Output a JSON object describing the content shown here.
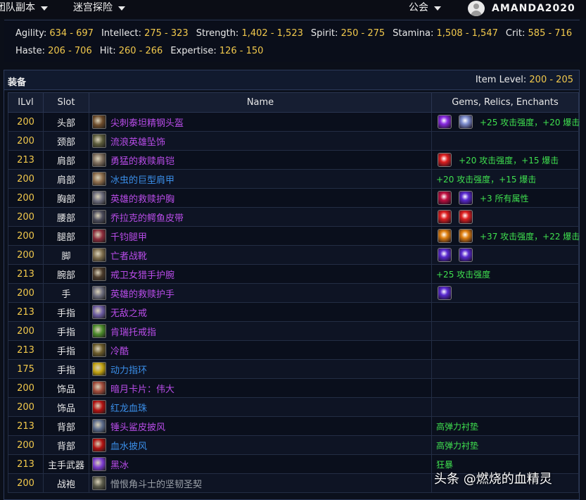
{
  "nav": {
    "item1": "团队副本",
    "item2": "迷宫探险",
    "guild": "公会",
    "username": "AMANDA2020"
  },
  "stats": {
    "row1": [
      {
        "label": "Agility:",
        "value": "634 - 697"
      },
      {
        "label": "Intellect:",
        "value": "275 - 323"
      },
      {
        "label": "Strength:",
        "value": "1,402 - 1,523"
      },
      {
        "label": "Spirit:",
        "value": "250 - 275"
      },
      {
        "label": "Stamina:",
        "value": "1,508 - 1,547"
      },
      {
        "label": "Crit:",
        "value": "585 - 716"
      }
    ],
    "row2": [
      {
        "label": "Haste:",
        "value": "206 - 706"
      },
      {
        "label": "Hit:",
        "value": "260 - 266"
      },
      {
        "label": "Expertise:",
        "value": "126 - 150"
      }
    ]
  },
  "equipment": {
    "title": "装备",
    "item_level_label": "Item Level:",
    "item_level_value": "200 - 205",
    "columns": {
      "ilvl": "ILvl",
      "slot": "Slot",
      "name": "Name",
      "gems": "Gems, Relics, Enchants"
    },
    "rows": [
      {
        "ilvl": "200",
        "slot": "头部",
        "name": "尖刺泰坦精钢头盔",
        "quality": "epic",
        "icon_color": "#6b4a2a",
        "gems": [
          "#8a2be2",
          "#8090d0"
        ],
        "enchant": "+25 攻击强度，+20 爆击"
      },
      {
        "ilvl": "200",
        "slot": "颈部",
        "name": "流浪英雄坠饰",
        "quality": "epic",
        "icon_color": "#5a5a3a",
        "gems": [],
        "enchant": ""
      },
      {
        "ilvl": "213",
        "slot": "肩部",
        "name": "勇猛的救赎肩铠",
        "quality": "epic",
        "icon_color": "#7a6a5a",
        "gems": [
          "#e02020"
        ],
        "enchant": "+20 攻击强度，+15 爆击"
      },
      {
        "ilvl": "200",
        "slot": "肩部",
        "name": "冰虫的巨型肩甲",
        "quality": "rare",
        "icon_color": "#8a6a4a",
        "gems": [],
        "enchant": "+20 攻击强度，+15 爆击"
      },
      {
        "ilvl": "200",
        "slot": "胸部",
        "name": "英雄的救赎护胸",
        "quality": "epic",
        "icon_color": "#6a6a7a",
        "gems": [
          "#c01040",
          "#5a2ad0"
        ],
        "enchant": "+3 所有属性"
      },
      {
        "ilvl": "200",
        "slot": "腰部",
        "name": "乔拉克的鳄鱼皮带",
        "quality": "epic",
        "icon_color": "#4a4a5a",
        "gems": [
          "#e02020",
          "#e02020"
        ],
        "enchant": ""
      },
      {
        "ilvl": "200",
        "slot": "腿部",
        "name": "千钧腿甲",
        "quality": "epic",
        "icon_color": "#8a2a3a",
        "gems": [
          "#e08010",
          "#e08010"
        ],
        "enchant": "+37 攻击强度，+22 爆击"
      },
      {
        "ilvl": "200",
        "slot": "脚",
        "name": "亡者战靴",
        "quality": "epic",
        "icon_color": "#7a6a4a",
        "gems": [
          "#5a2ad0",
          "#5a2ad0"
        ],
        "enchant": ""
      },
      {
        "ilvl": "213",
        "slot": "腕部",
        "name": "戒卫女猎手护腕",
        "quality": "epic",
        "icon_color": "#4a3a2a",
        "gems": [],
        "enchant": "+25 攻击强度"
      },
      {
        "ilvl": "200",
        "slot": "手",
        "name": "英雄的救赎护手",
        "quality": "epic",
        "icon_color": "#6a6a7a",
        "gems": [
          "#5a2ad0"
        ],
        "enchant": ""
      },
      {
        "ilvl": "213",
        "slot": "手指",
        "name": "无敌之戒",
        "quality": "epic",
        "icon_color": "#6a5aa0",
        "gems": [],
        "enchant": ""
      },
      {
        "ilvl": "200",
        "slot": "手指",
        "name": "肯瑞托戒指",
        "quality": "epic",
        "icon_color": "#4a8a2a",
        "gems": [],
        "enchant": ""
      },
      {
        "ilvl": "213",
        "slot": "手指",
        "name": "冷酷",
        "quality": "epic",
        "icon_color": "#6a5a2a",
        "gems": [],
        "enchant": ""
      },
      {
        "ilvl": "175",
        "slot": "手指",
        "name": "动力指环",
        "quality": "rare",
        "icon_color": "#c0a010",
        "gems": [],
        "enchant": ""
      },
      {
        "ilvl": "200",
        "slot": "饰品",
        "name": "暗月卡片：伟大",
        "quality": "epic",
        "icon_color": "#a04a3a",
        "gems": [],
        "enchant": ""
      },
      {
        "ilvl": "200",
        "slot": "饰品",
        "name": "红龙血珠",
        "quality": "rare",
        "icon_color": "#b01010",
        "gems": [],
        "enchant": ""
      },
      {
        "ilvl": "213",
        "slot": "背部",
        "name": "锤头鲨皮披风",
        "quality": "epic",
        "icon_color": "#5a6a8a",
        "gems": [],
        "enchant": "高弹力衬垫"
      },
      {
        "ilvl": "200",
        "slot": "背部",
        "name": "血水披风",
        "quality": "rare",
        "icon_color": "#b01010",
        "gems": [],
        "enchant": "高弹力衬垫"
      },
      {
        "ilvl": "213",
        "slot": "主手武器",
        "name": "黑冰",
        "quality": "epic",
        "icon_color": "#7a3ad0",
        "gems": [],
        "enchant": "狂暴"
      },
      {
        "ilvl": "200",
        "slot": "战袍",
        "name": "憎恨角斗士的坚韧圣契",
        "quality": "common",
        "icon_color": "#5a5a4a",
        "gems": [],
        "enchant": ""
      }
    ]
  },
  "watermark": "头条 @燃烧的血精灵"
}
